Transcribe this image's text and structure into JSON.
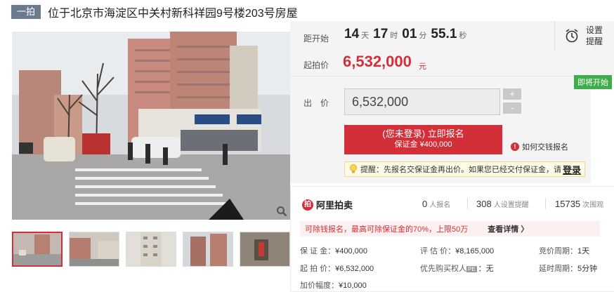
{
  "header": {
    "badge": "一拍",
    "title": "位于北京市海淀区中关村新科祥园9号楼203号房屋"
  },
  "countdown": {
    "label": "距开始",
    "days": "14",
    "days_unit": "天",
    "hours": "17",
    "hours_unit": "时",
    "minutes": "01",
    "minutes_unit": "分",
    "seconds": "55.1",
    "seconds_unit": "秒"
  },
  "start_price": {
    "label": "起拍价",
    "value": "6,532,000",
    "unit": "元"
  },
  "remind": {
    "line1": "设置",
    "line2": "提醒"
  },
  "status_tag": "即将开始",
  "bid": {
    "label": "出价",
    "input_value": "6,532,000",
    "plus": "+",
    "minus": "-",
    "signup_main": "(您未登录) 立即报名",
    "signup_sub": "保证金 ¥400,000",
    "how_pay_icon": "!",
    "how_pay": "如何交钱报名"
  },
  "tip": {
    "prefix": "提醒：先报名交保证金再出价。如果您已经交付保证金，请",
    "link": "登录"
  },
  "stats": {
    "logo_text": "阿里拍卖",
    "signups": "0",
    "signups_label": "人报名",
    "reminders": "308",
    "reminders_label": "人设置提醒",
    "views": "15735",
    "views_label": "次围观"
  },
  "deposit_notice": {
    "text": "可除钱报名，最高可除保证金的70%，上限50万",
    "link": "查看详情 〉"
  },
  "details": {
    "deposit_label": "保 证 金：",
    "deposit_value": "¥400,000",
    "appraisal_label": "评 估 价：",
    "appraisal_value": "¥8,165,000",
    "cycle_label": "竞价周期：",
    "cycle_value": "1天",
    "start_label": "起 拍 价：",
    "start_value": "¥6,532,000",
    "priority_label": "优先购买权人",
    "priority_flag": "PE",
    "priority_value": "：无",
    "delay_label": "延时周期：",
    "delay_value": "5分钟",
    "increment_label": "加价幅度：",
    "increment_value": "¥10,000"
  },
  "icons": {
    "zoom": "magnifier-icon",
    "alarm": "alarm-clock-icon",
    "info": "exclamation-icon",
    "bulb": "lightbulb-icon"
  },
  "colors": {
    "accent": "#d22f38",
    "badge": "#6b7a8f",
    "soon": "#3fae4a"
  }
}
